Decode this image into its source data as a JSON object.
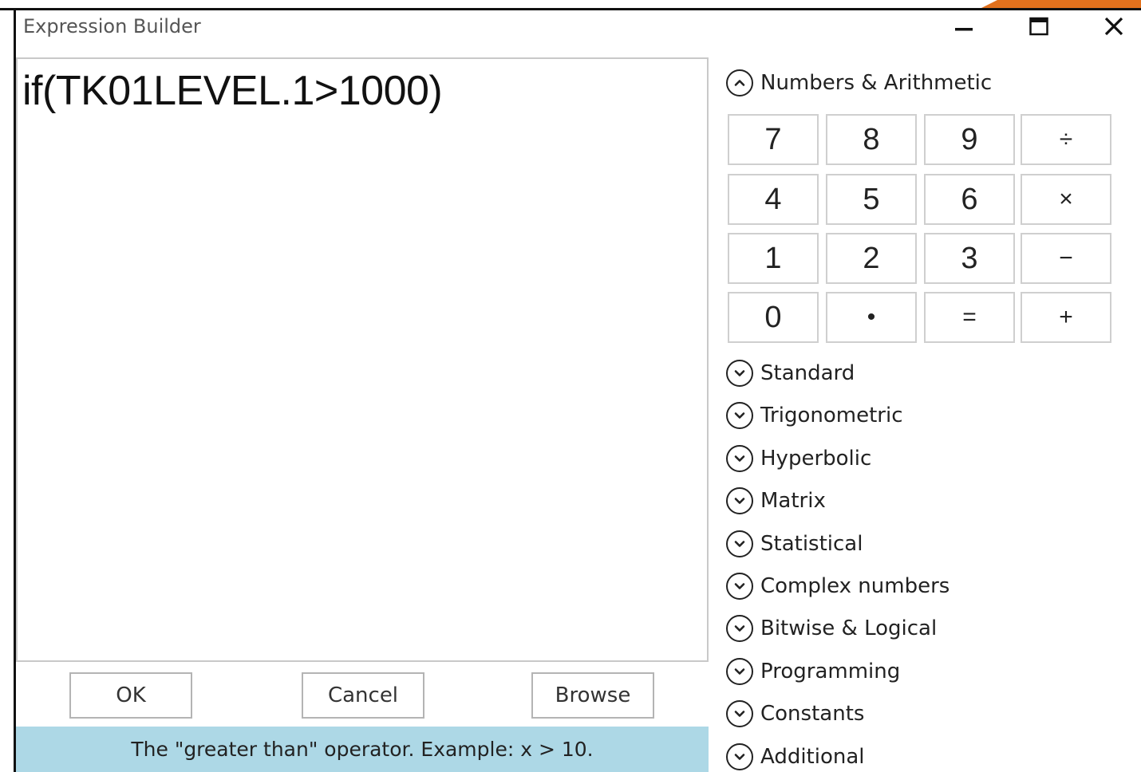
{
  "window": {
    "title": "Expression Builder",
    "controls": {
      "minimize": "minimize-icon",
      "maximize": "maximize-icon",
      "close": "close-icon"
    }
  },
  "editor": {
    "expression": "if(TK01LEVEL.1>1000)"
  },
  "buttons": {
    "ok": "OK",
    "cancel": "Cancel",
    "browse": "Browse"
  },
  "status": {
    "message": "The \"greater than\" operator. Example: x > 10."
  },
  "panel": {
    "expanded_section": {
      "label": "Numbers & Arithmetic",
      "icon": "chevron-up-icon"
    },
    "keypad": [
      [
        "7",
        "8",
        "9",
        "÷"
      ],
      [
        "4",
        "5",
        "6",
        "×"
      ],
      [
        "1",
        "2",
        "3",
        "−"
      ],
      [
        "0",
        "•",
        "=",
        "+"
      ]
    ],
    "collapsed_sections": [
      "Standard",
      "Trigonometric",
      "Hyperbolic",
      "Matrix",
      "Statistical",
      "Complex numbers",
      "Bitwise & Logical",
      "Programming",
      "Constants",
      "Additional"
    ],
    "collapsed_icon": "chevron-down-icon"
  },
  "colors": {
    "status_bar": "#add8e6",
    "accent": "#e2711d",
    "border": "#c9c9c9"
  }
}
